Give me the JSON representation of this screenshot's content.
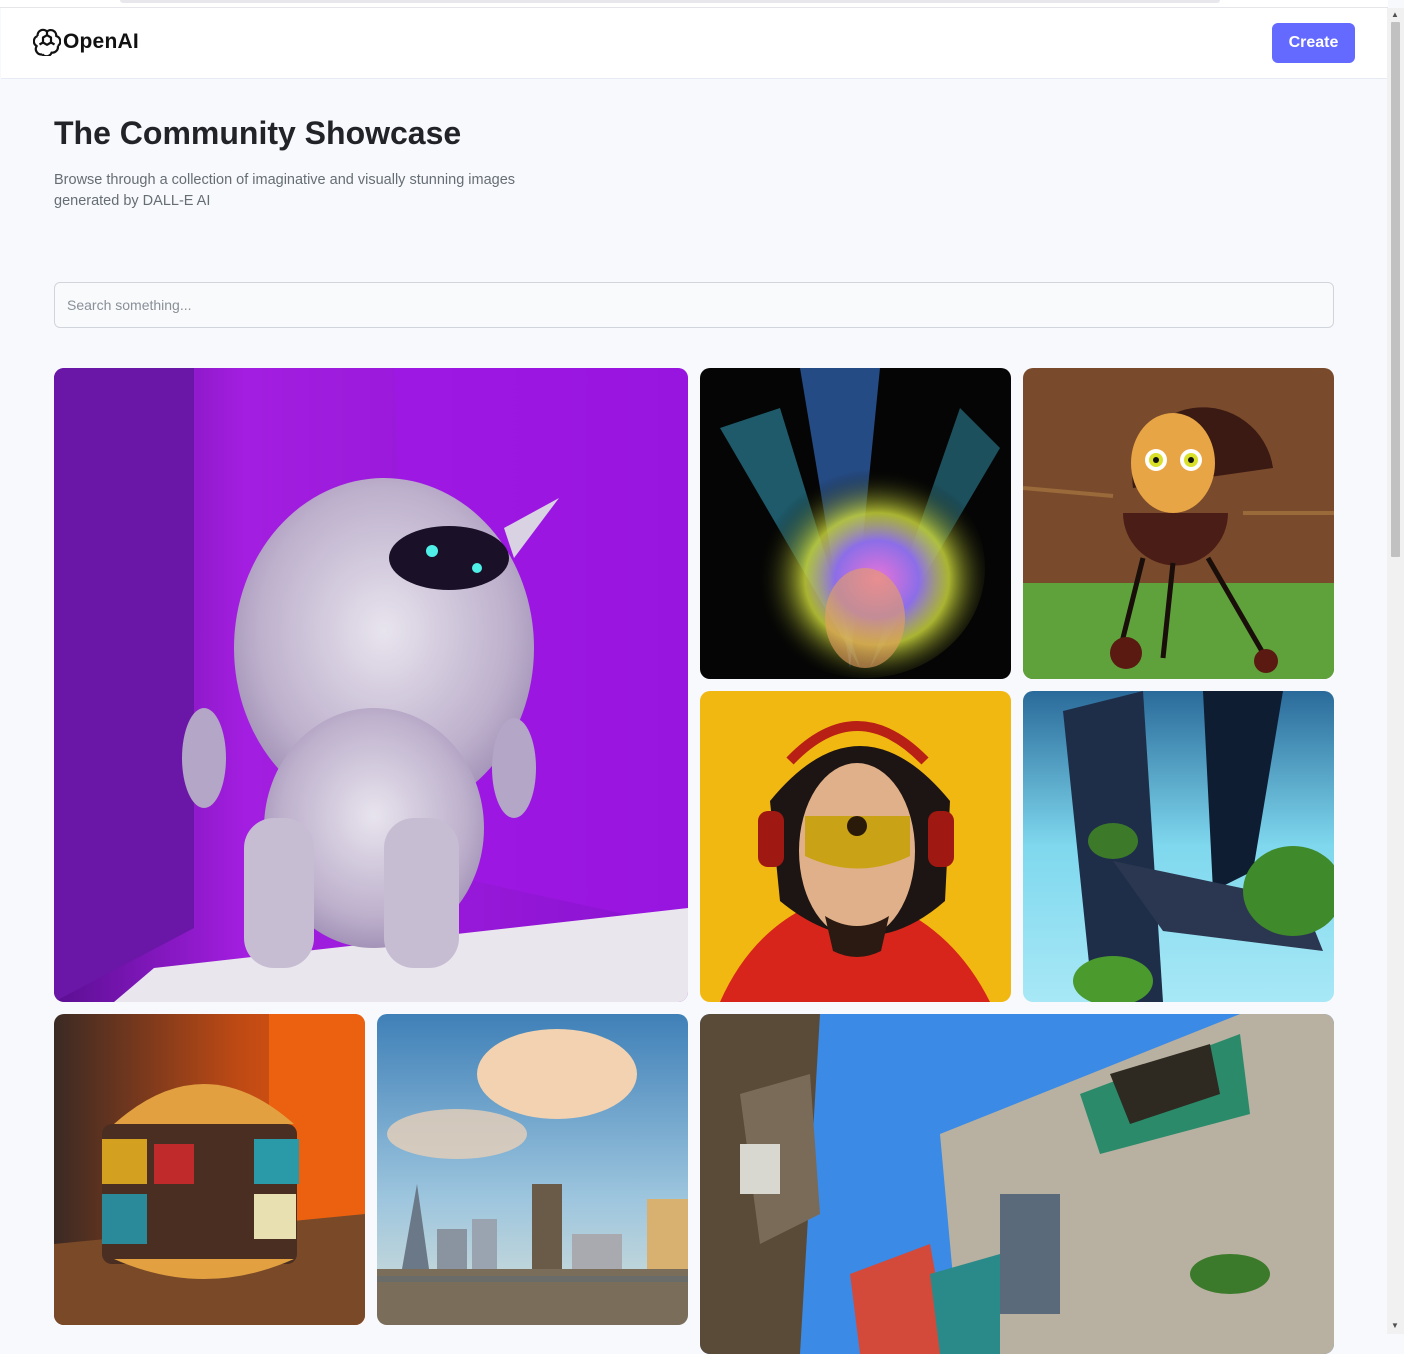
{
  "header": {
    "brand": "OpenAI",
    "create_label": "Create",
    "logo_icon": "openai-logo-icon"
  },
  "hero": {
    "title": "The Community Showcase",
    "subtitle": "Browse through a collection of imaginative and visually stunning images generated by DALL-E AI"
  },
  "search": {
    "placeholder": "Search something..."
  },
  "gallery": [
    {
      "subject": "furry-monster"
    },
    {
      "subject": "color-explosion"
    },
    {
      "subject": "grill-egg-cartoon"
    },
    {
      "subject": "headphone-hero"
    },
    {
      "subject": "futuristic-city"
    },
    {
      "subject": "rubiks-burger"
    },
    {
      "subject": "city-skyline"
    },
    {
      "subject": "old-buildings"
    }
  ],
  "colors": {
    "accent": "#6469ff",
    "background": "#f8f9fc",
    "title": "#222328",
    "subtitle": "#666e75"
  }
}
